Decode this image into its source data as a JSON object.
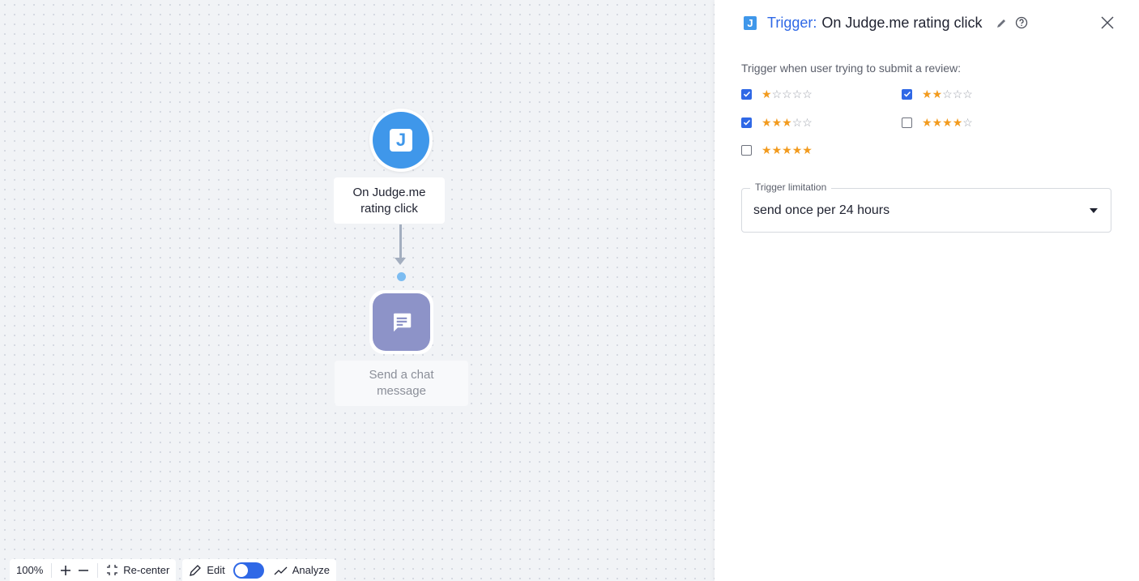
{
  "canvas": {
    "trigger_node": {
      "icon": "judgeme-j-icon",
      "badge_letter": "J",
      "label": "On Judge.me rating click"
    },
    "action_node": {
      "icon": "chat-message-icon",
      "label": "Send a chat message"
    }
  },
  "toolbar": {
    "zoom_level": "100%",
    "zoom_in_icon": "plus-icon",
    "zoom_out_icon": "minus-icon",
    "recenter_label": "Re-center",
    "edit_label": "Edit",
    "analyze_label": "Analyze",
    "mode_toggle_on": true
  },
  "panel": {
    "logo_letter": "J",
    "title_prefix": "Trigger:",
    "title_name": "On Judge.me rating click",
    "prompt": "Trigger when user trying to submit a review:",
    "ratings": [
      {
        "stars": 1,
        "checked": true
      },
      {
        "stars": 2,
        "checked": true
      },
      {
        "stars": 3,
        "checked": true
      },
      {
        "stars": 4,
        "checked": false
      },
      {
        "stars": 5,
        "checked": false
      }
    ],
    "limitation": {
      "legend": "Trigger limitation",
      "value": "send once per 24 hours"
    }
  },
  "colors": {
    "accent": "#2f68e6",
    "judgeme_blue": "#3f97ea",
    "star_filled": "#f29b1e",
    "action_purple": "#8d93c8"
  }
}
